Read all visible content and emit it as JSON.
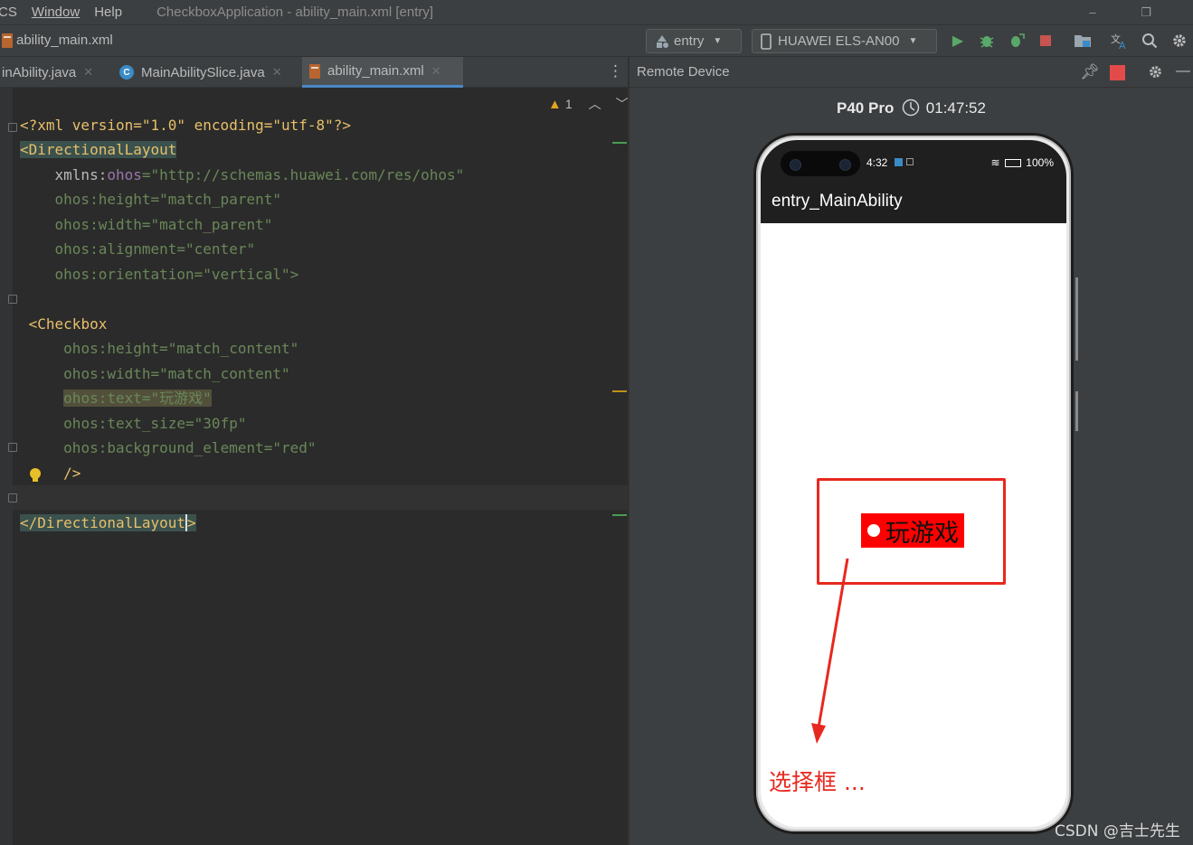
{
  "menubar": {
    "items": [
      "CS",
      "Window",
      "Help"
    ],
    "window_title": "CheckboxApplication - ability_main.xml [entry]",
    "minimize": "–",
    "restore": "❐"
  },
  "toolbar": {
    "breadcrumb": "ability_main.xml",
    "run_config": "entry",
    "device": "HUAWEI ELS-AN00"
  },
  "tabs": [
    {
      "label": "inAbility.java",
      "active": false
    },
    {
      "label": "MainAbilitySlice.java",
      "active": false
    },
    {
      "label": "ability_main.xml",
      "active": true
    }
  ],
  "editor": {
    "warning_count": "1",
    "lines": {
      "l1": "<?xml version=\"1.0\" encoding=\"utf-8\"?>",
      "l2_tag": "<DirectionalLayout",
      "l3_attr": "xmlns:",
      "l3_ns": "ohos",
      "l3_val": "=\"http://schemas.huawei.com/res/ohos\"",
      "l4": "ohos:height=\"match_parent\"",
      "l5": "ohos:width=\"match_parent\"",
      "l6": "ohos:alignment=\"center\"",
      "l7": "ohos:orientation=\"vertical\">",
      "l9_tag": "<Checkbox",
      "l10": "ohos:height=\"match_content\"",
      "l11": "ohos:width=\"match_content\"",
      "l12": "ohos:text=\"玩游戏\"",
      "l13": "ohos:text_size=\"30fp\"",
      "l14": "ohos:background_element=\"red\"",
      "l15": "/>",
      "l17_tag": "</DirectionalLayout",
      "l17_end": ">"
    }
  },
  "remote_device": {
    "title": "Remote Device",
    "model": "P40 Pro",
    "timer": "01:47:52"
  },
  "phone": {
    "status_time": "4:32",
    "battery": "100%",
    "app_title": "entry_MainAbility",
    "checkbox_text": "玩游戏",
    "checkbox_bg": "#ff0000"
  },
  "annotation": {
    "label": "选择框 ...",
    "color": "#e8281e"
  },
  "watermark": "CSDN @吉士先生",
  "colors": {
    "tag": "#e8bf6a",
    "namespace": "#9876aa",
    "value": "#6a8759",
    "accent_tab": "#4a88c7"
  }
}
